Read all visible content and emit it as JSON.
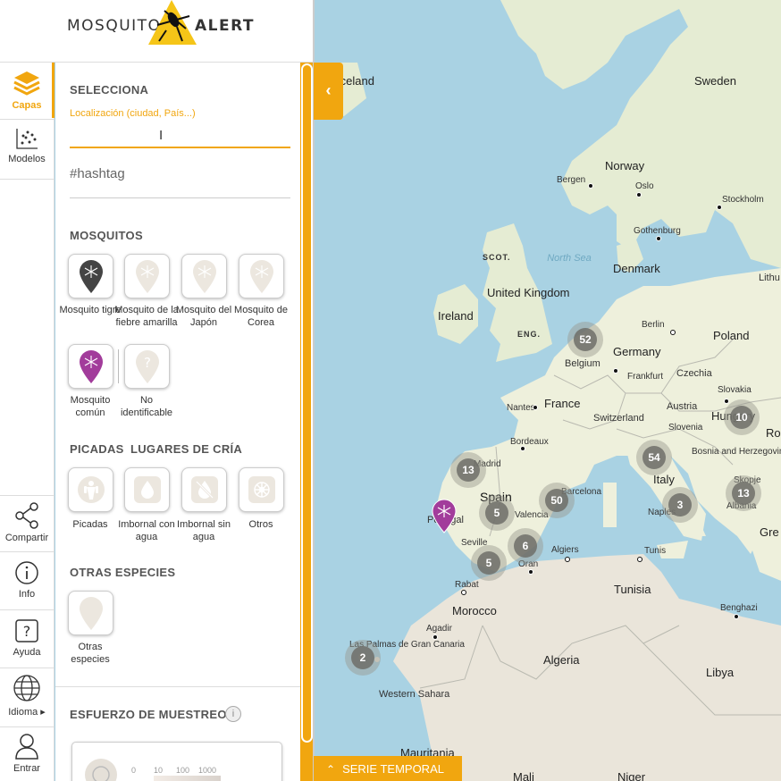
{
  "header": {
    "logo_left": "MOSQUITO",
    "logo_right": "ALERT"
  },
  "rail": {
    "items": [
      {
        "label": "Capas",
        "icon": "layers-icon"
      },
      {
        "label": "Modelos",
        "icon": "scatter-models-icon"
      },
      {
        "label": "Compartir",
        "icon": "share-icon"
      },
      {
        "label": "Info",
        "icon": "info-icon"
      },
      {
        "label": "Ayuda",
        "icon": "help-icon"
      },
      {
        "label": "Idioma ▸",
        "icon": "globe-icon"
      },
      {
        "label": "Entrar",
        "icon": "user-icon"
      }
    ]
  },
  "panel": {
    "select_title": "SELECCIONA",
    "location_placeholder": "Localización (ciudad, País...)",
    "hashtag_placeholder": "#hashtag",
    "mosquitos_title": "MOSQUITOS",
    "mosquitos": [
      {
        "label": "Mosquito tigre"
      },
      {
        "label": "Mosquito de la fiebre amarilla"
      },
      {
        "label": "Mosquito del Japón"
      },
      {
        "label": "Mosquito de Corea"
      },
      {
        "label": "Mosquito común"
      },
      {
        "label": "No identificable"
      }
    ],
    "picadas_title": "PICADAS",
    "lugares_title": "LUGARES DE CRÍA",
    "breeding": [
      {
        "label": "Picadas"
      },
      {
        "label": "Imbornal con agua"
      },
      {
        "label": "Imbornal sin agua"
      },
      {
        "label": "Otros"
      }
    ],
    "otras_title": "OTRAS ESPECIES",
    "otras": [
      {
        "label": "Otras especies"
      }
    ],
    "esfuerzo_title": "ESFUERZO DE MUESTREO",
    "legend_values": [
      "0",
      "10",
      "100",
      "1000"
    ]
  },
  "map": {
    "labels": {
      "iceland": "Iceland",
      "sweden": "Sweden",
      "norway": "Norway",
      "bergen": "Bergen",
      "oslo": "Oslo",
      "stockholm": "Stockholm",
      "gothenburg": "Gothenburg",
      "north_sea": "North Sea",
      "scot": "SCOT.",
      "denmark": "Denmark",
      "lithu": "Lithu",
      "united_kingdom": "United Kingdom",
      "ireland": "Ireland",
      "eng": "ENG.",
      "berlin": "Berlin",
      "poland": "Poland",
      "germany": "Germany",
      "belgium": "Belgium",
      "frankfurt": "Frankfurt",
      "czechia": "Czechia",
      "slovakia": "Slovakia",
      "france": "France",
      "nantes": "Nantes",
      "austria": "Austria",
      "hungary": "Hungary",
      "switzerland": "Switzerland",
      "slovenia": "Slovenia",
      "ro": "Ro",
      "bordeaux": "Bordeaux",
      "bosnia": "Bosnia and Herzegovina",
      "italy": "Italy",
      "madrid": "Madrid",
      "spain": "Spain",
      "barcelona": "Barcelona",
      "skopje": "Skopje",
      "albania": "Albania",
      "portugal": "Portugal",
      "valencia": "Valencia",
      "naples": "Naples",
      "gre": "Gre",
      "seville": "Seville",
      "algiers": "Algiers",
      "oran": "Oran",
      "tunis": "Tunis",
      "rabat": "Rabat",
      "tunisia": "Tunisia",
      "morocco": "Morocco",
      "agadir": "Agadir",
      "benghazi": "Benghazi",
      "las_palmas": "Las Palmas de Gran Canaria",
      "algeria": "Algeria",
      "libya": "Libya",
      "western_sahara": "Western Sahara",
      "mauritania": "Mauritania",
      "mali": "Mali",
      "niger": "Niger"
    },
    "clusters": [
      {
        "id": "ireland-uk",
        "count": "52"
      },
      {
        "id": "hungary",
        "count": "10"
      },
      {
        "id": "portugal-north",
        "count": "13"
      },
      {
        "id": "italy-north",
        "count": "54"
      },
      {
        "id": "albania",
        "count": "13"
      },
      {
        "id": "barcelona",
        "count": "50"
      },
      {
        "id": "spain",
        "count": "5"
      },
      {
        "id": "naples",
        "count": "3"
      },
      {
        "id": "andalusia",
        "count": "6"
      },
      {
        "id": "seville",
        "count": "5"
      },
      {
        "id": "canaries",
        "count": "2"
      }
    ],
    "collapse_icon": "chevron-left-icon"
  },
  "bottom": {
    "serie_label": "SERIE TEMPORAL",
    "icon": "chevron-up-icon"
  },
  "colors": {
    "accent": "#f1a60f",
    "sea": "#a9d2e3",
    "land": "#eef0dc",
    "desert": "#eae5da",
    "cluster": "#6e6e69",
    "pin_common": "#a23c9b",
    "pin_tiger": "#444444"
  }
}
